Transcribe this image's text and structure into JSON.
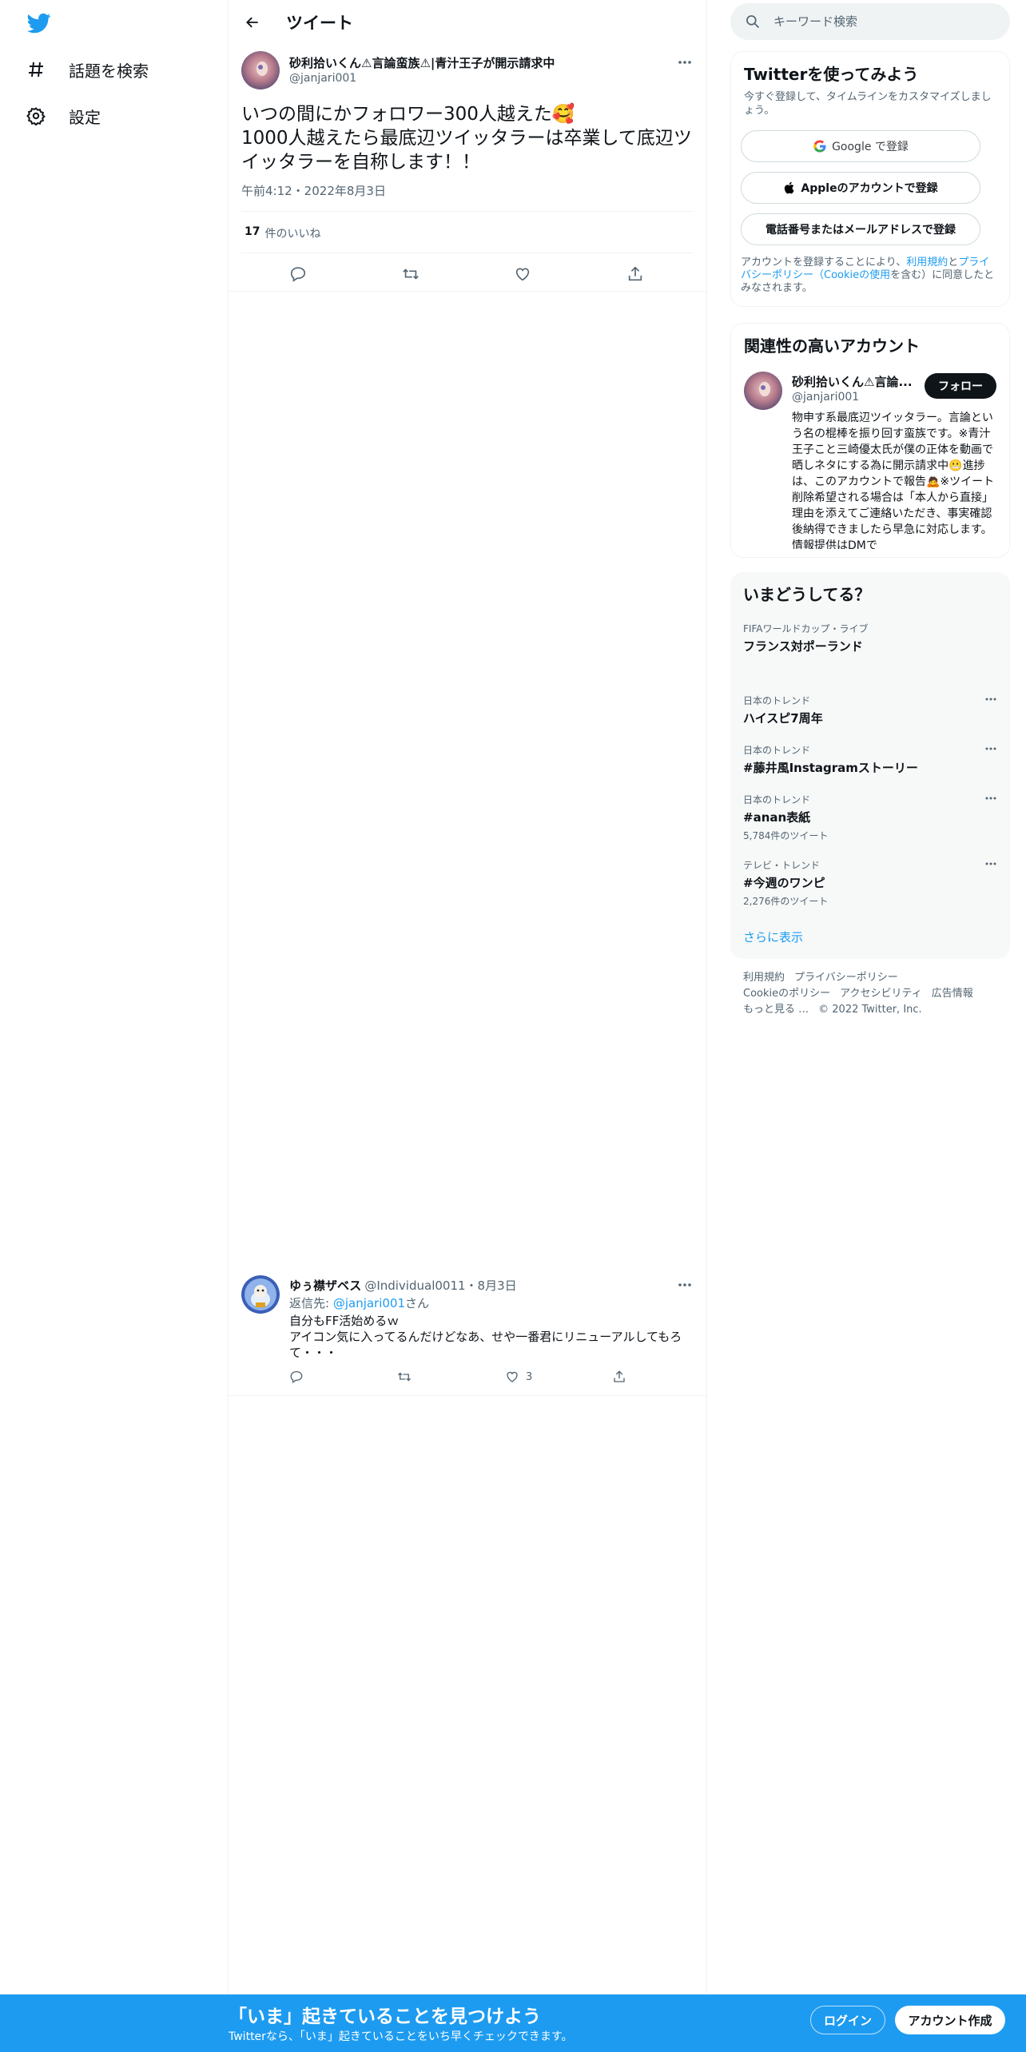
{
  "colors": {
    "brand": "#1d9bf0",
    "text": "#0f1419",
    "muted": "#536471"
  },
  "nav": {
    "logo": "twitter-bird-icon",
    "items": [
      {
        "icon": "hashtag-icon",
        "label": "話題を検索"
      },
      {
        "icon": "gear-icon",
        "label": "設定"
      }
    ]
  },
  "header": {
    "title": "ツイート",
    "back_icon": "arrow-left-icon"
  },
  "tweet": {
    "name": "砂利拾いくん⚠言論蛮族⚠|青汁王子が開示請求中",
    "handle": "@janjari001",
    "text": "いつの間にかフォロワー300人越えた🥰\n1000人越えたら最底辺ツイッタラーは卒業して底辺ツイッタラーを自称します！！",
    "time": "午前4:12・2022年8月3日",
    "likes_count": "17",
    "likes_label": "件のいいね",
    "actions": [
      "reply-icon",
      "retweet-icon",
      "like-icon",
      "share-icon"
    ]
  },
  "reply": {
    "name": "ゆぅ襟ザベス",
    "handle_date": "@Individual0011・8月3日",
    "reply_to_prefix": "返信先: ",
    "reply_to_mention": "@janjari001",
    "reply_to_suffix": "さん",
    "text": "自分もFF活始めるｗ\nアイコン気に入ってるんだけどなあ、せや一番君にリニューアルしてもろて・・・",
    "like_count": "3"
  },
  "search": {
    "placeholder": "キーワード検索"
  },
  "signup": {
    "title": "Twitterを使ってみよう",
    "subtitle": "今すぐ登録して、タイムラインをカスタマイズしましょう。",
    "google": "Google で登録",
    "apple": "Appleのアカウントで登録",
    "phone": "電話番号またはメールアドレスで登録",
    "terms_prefix": "アカウントを登録することにより、",
    "terms_link1": "利用規約",
    "terms_and": "と",
    "terms_link2": "プライバシーポリシー（Cookieの使用",
    "terms_suffix": "を含む）に同意したとみなされます。"
  },
  "related": {
    "title": "関連性の高いアカウント",
    "name": "砂利拾いくん⚠言論...",
    "handle": "@janjari001",
    "follow": "フォロー",
    "bio": "物申す系最底辺ツイッタラー。言論という名の棍棒を振り回す蛮族です。※青汁王子こと三崎優太氏が僕の正体を動画で晒しネタにする為に開示請求中😬進捗は、このアカウントで報告🙇※ツイート削除希望される場合は「本人から直接」理由を添えてご連絡いただき、事実確認後納得できましたら早急に対応します。情報提供はDMで"
  },
  "trends": {
    "title": "いまどうしてる？",
    "items": [
      {
        "category": "FIFAワールドカップ・ライブ",
        "title": "フランス対ポーランド",
        "count": ""
      },
      {
        "category": "日本のトレンド",
        "title": "ハイスピ7周年",
        "count": ""
      },
      {
        "category": "日本のトレンド",
        "title": "#藤井風Instagramストーリー",
        "count": ""
      },
      {
        "category": "日本のトレンド",
        "title": "#anan表紙",
        "count": "5,784件のツイート"
      },
      {
        "category": "テレビ・トレンド",
        "title": "#今週のワンピ",
        "count": "2,276件のツイート"
      }
    ],
    "show_more": "さらに表示"
  },
  "footer": {
    "links": [
      "利用規約",
      "プライバシーポリシー",
      "Cookieのポリシー",
      "アクセシビリティ",
      "広告情報",
      "もっと見る …"
    ],
    "copyright": "© 2022 Twitter, Inc."
  },
  "bottom_bar": {
    "title": "「いま」起きていることを見つけよう",
    "subtitle": "Twitterなら、「いま」起きていることをいち早くチェックできます。",
    "login": "ログイン",
    "signup": "アカウント作成"
  }
}
